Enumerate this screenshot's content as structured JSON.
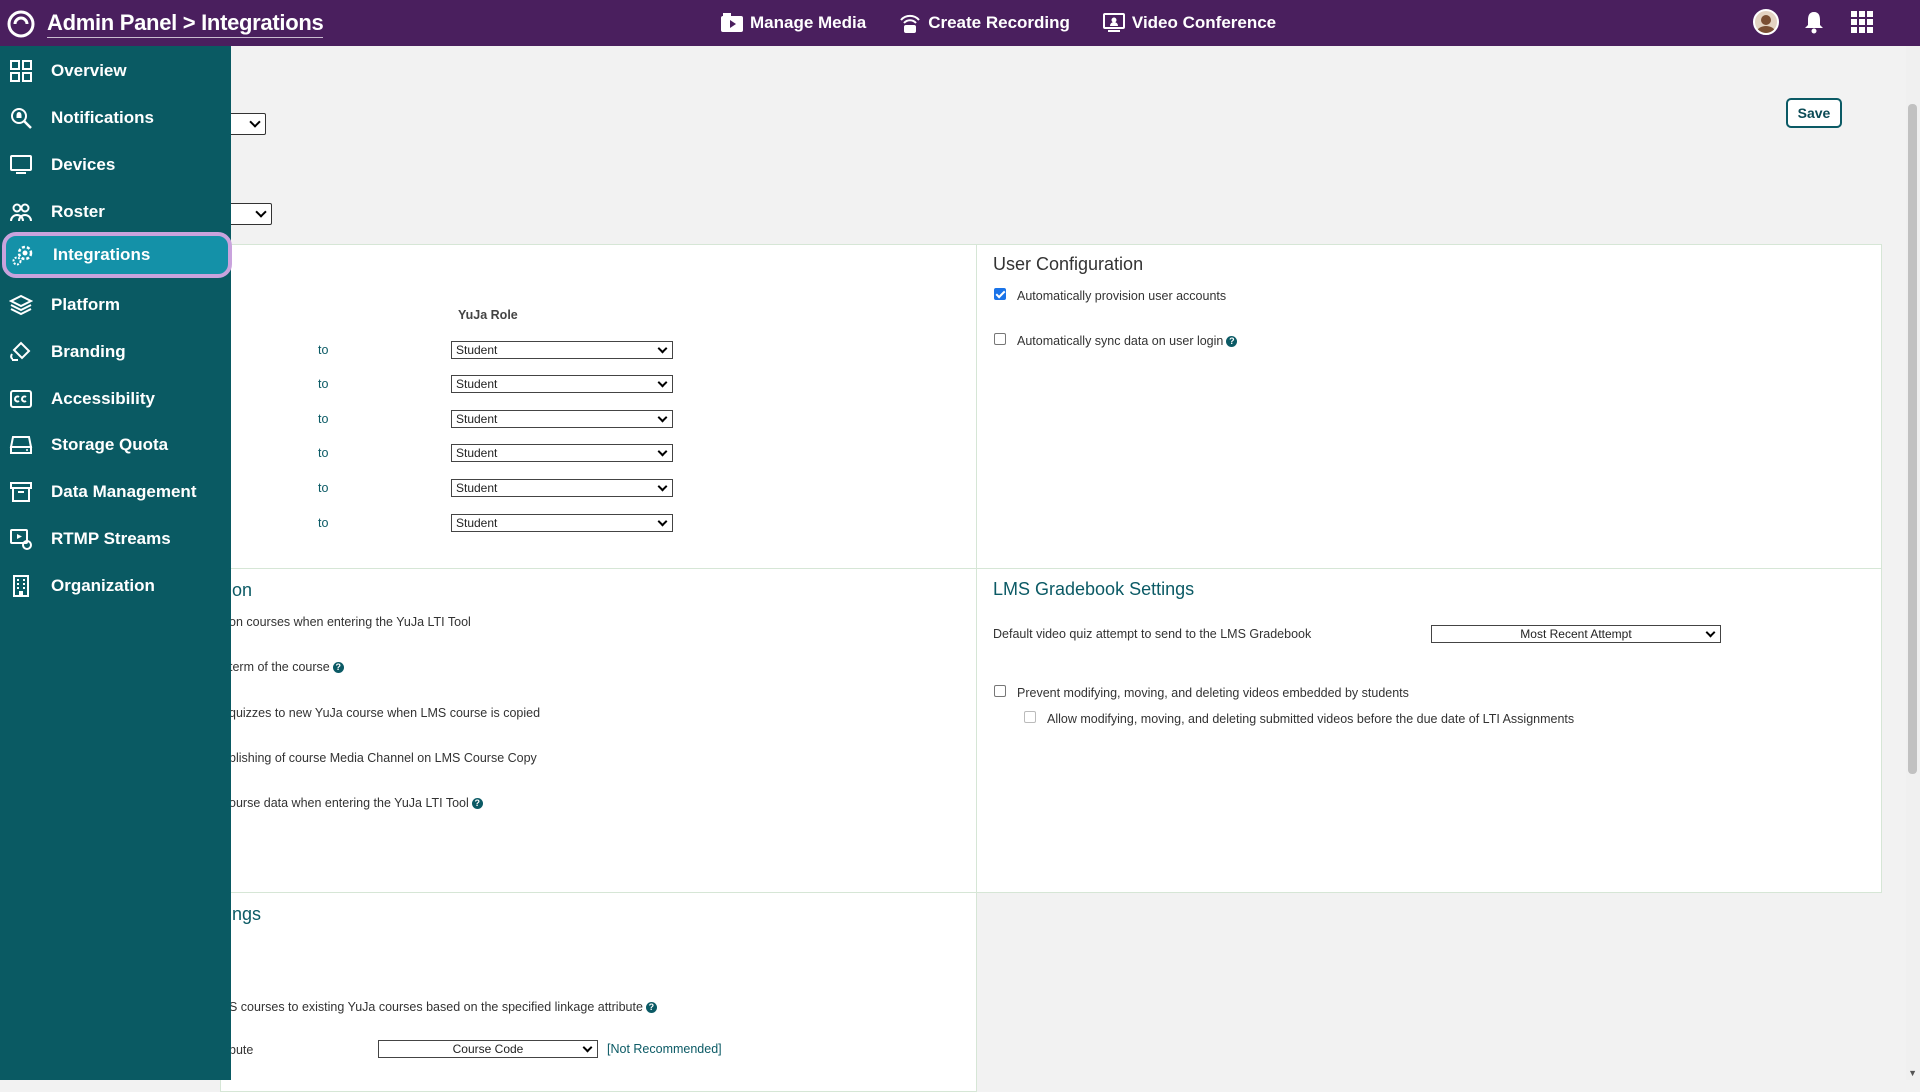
{
  "header": {
    "title": "Admin Panel > Integrations",
    "nav": [
      {
        "label": "Manage Media",
        "icon": "film-icon"
      },
      {
        "label": "Create Recording",
        "icon": "broadcast-icon"
      },
      {
        "label": "Video Conference",
        "icon": "monitor-user-icon"
      }
    ]
  },
  "sidebar": {
    "items": [
      {
        "label": "Overview",
        "icon": "grid-icon"
      },
      {
        "label": "Notifications",
        "icon": "bell-search-icon"
      },
      {
        "label": "Devices",
        "icon": "monitor-icon"
      },
      {
        "label": "Roster",
        "icon": "users-icon"
      },
      {
        "label": "Integrations",
        "icon": "cog-icon",
        "active": true
      },
      {
        "label": "Platform",
        "icon": "layers-icon"
      },
      {
        "label": "Branding",
        "icon": "paint-bucket-icon"
      },
      {
        "label": "Accessibility",
        "icon": "closed-caption-icon"
      },
      {
        "label": "Storage Quota",
        "icon": "hard-drive-icon"
      },
      {
        "label": "Data Management",
        "icon": "archive-icon"
      },
      {
        "label": "RTMP Streams",
        "icon": "stream-icon"
      },
      {
        "label": "Organization",
        "icon": "building-icon"
      }
    ]
  },
  "toolbar": {
    "save_label": "Save"
  },
  "role_mapping": {
    "column_header": "YuJa Role",
    "rows": [
      {
        "to": "to",
        "value": "Student"
      },
      {
        "to": "to",
        "value": "Student"
      },
      {
        "to": "to",
        "value": "Student"
      },
      {
        "to": "to",
        "value": "Student"
      },
      {
        "to": "to",
        "value": "Student"
      },
      {
        "to": "to",
        "value": "Student"
      }
    ]
  },
  "user_config": {
    "title": "User Configuration",
    "options": [
      {
        "label": "Automatically provision user accounts",
        "checked": true
      },
      {
        "label": "Automatically sync data on user login",
        "checked": false
      }
    ]
  },
  "course_section": {
    "title_fragment": "ion",
    "lines": [
      "on courses when entering the YuJa LTI Tool",
      "term of the course",
      "quizzes to new YuJa course when LMS course is copied",
      "blishing of course Media Channel on LMS Course Copy",
      "ourse data when entering the YuJa LTI Tool"
    ]
  },
  "gradebook": {
    "title": "LMS Gradebook Settings",
    "attempt_label": "Default video quiz attempt to send to the LMS Gradebook",
    "attempt_value": "Most Recent Attempt",
    "prevent_label": "Prevent modifying, moving, and deleting videos embedded by students",
    "allow_label": "Allow modifying, moving, and deleting submitted videos before the due date of LTI Assignments"
  },
  "linkage": {
    "title_fragment": "ings",
    "line": "S courses to existing YuJa courses based on the specified linkage attribute",
    "attr_label_fragment": "bute",
    "attr_value": "Course Code",
    "attr_note": "[Not Recommended]"
  }
}
